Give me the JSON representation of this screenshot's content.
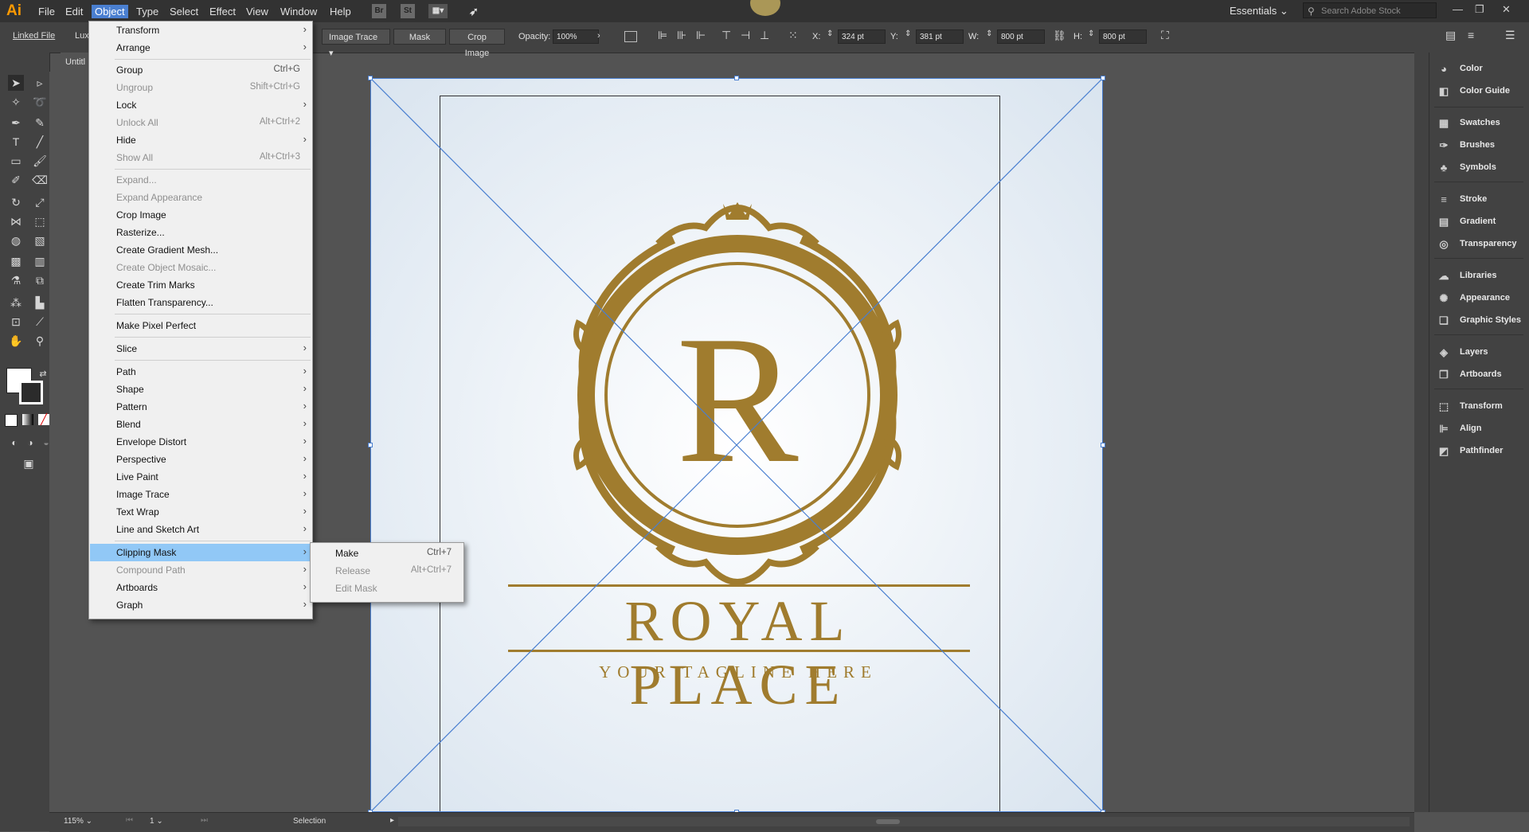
{
  "app": {
    "logo": "Ai",
    "workspace": "Essentials",
    "search_placeholder": "Search Adobe Stock"
  },
  "menubar": [
    "File",
    "Edit",
    "Object",
    "Type",
    "Select",
    "Effect",
    "View",
    "Window",
    "Help"
  ],
  "menubar_badges": {
    "br": "Br",
    "st": "St"
  },
  "controlbar": {
    "linked_file": "Linked File",
    "lux": "Lux",
    "image_trace": "Image Trace",
    "mask": "Mask",
    "crop_image": "Crop Image",
    "opacity_label": "Opacity:",
    "opacity_value": "100%",
    "x_label": "X:",
    "x_value": "324 pt",
    "y_label": "Y:",
    "y_value": "381 pt",
    "w_label": "W:",
    "w_value": "800 pt",
    "h_label": "H:",
    "h_value": "800 pt"
  },
  "document": {
    "tab_title": "Untitl"
  },
  "artwork": {
    "monogram": "R",
    "brand": "ROYAL PLACE",
    "tagline": "YOUR TAGLINE HERE",
    "gold": "#a07c2e"
  },
  "object_menu": {
    "transform": "Transform",
    "arrange": "Arrange",
    "group": "Group",
    "group_sc": "Ctrl+G",
    "ungroup": "Ungroup",
    "ungroup_sc": "Shift+Ctrl+G",
    "lock": "Lock",
    "unlock_all": "Unlock All",
    "unlock_all_sc": "Alt+Ctrl+2",
    "hide": "Hide",
    "show_all": "Show All",
    "show_all_sc": "Alt+Ctrl+3",
    "expand": "Expand...",
    "expand_appearance": "Expand Appearance",
    "crop_image": "Crop Image",
    "rasterize": "Rasterize...",
    "create_gradient_mesh": "Create Gradient Mesh...",
    "create_object_mosaic": "Create Object Mosaic...",
    "create_trim_marks": "Create Trim Marks",
    "flatten_transparency": "Flatten Transparency...",
    "make_pixel_perfect": "Make Pixel Perfect",
    "slice": "Slice",
    "path": "Path",
    "shape": "Shape",
    "pattern": "Pattern",
    "blend": "Blend",
    "envelope_distort": "Envelope Distort",
    "perspective": "Perspective",
    "live_paint": "Live Paint",
    "image_trace": "Image Trace",
    "text_wrap": "Text Wrap",
    "line_sketch": "Line and Sketch Art",
    "clipping_mask": "Clipping Mask",
    "compound_path": "Compound Path",
    "artboards": "Artboards",
    "graph": "Graph"
  },
  "clip_submenu": {
    "make": "Make",
    "make_sc": "Ctrl+7",
    "release": "Release",
    "release_sc": "Alt+Ctrl+7",
    "edit_mask": "Edit Mask"
  },
  "panels": [
    "Color",
    "Color Guide",
    "Swatches",
    "Brushes",
    "Symbols",
    "Stroke",
    "Gradient",
    "Transparency",
    "Libraries",
    "Appearance",
    "Graphic Styles",
    "Layers",
    "Artboards",
    "Transform",
    "Align",
    "Pathfinder"
  ],
  "statusbar": {
    "zoom": "115%",
    "artboard_num": "1",
    "tool": "Selection"
  }
}
